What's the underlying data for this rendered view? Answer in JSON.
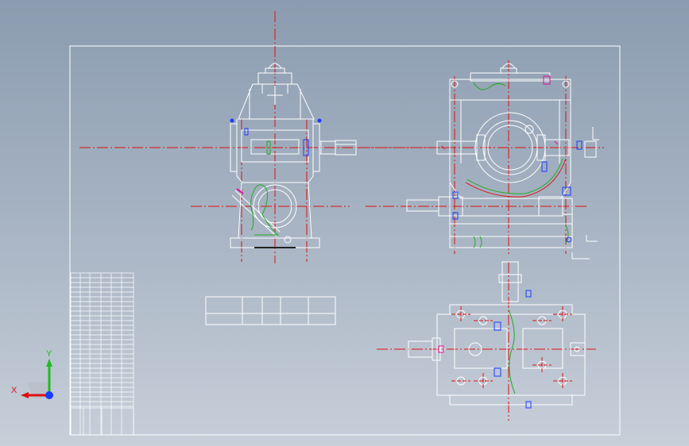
{
  "colors": {
    "background_top": "#8b9cb0",
    "background_bottom": "#c7cfd9",
    "line_white": "#ffffff",
    "centerline_red": "#dd1111",
    "break_green": "#22aa22",
    "part_blue": "#1a3cff",
    "part_magenta": "#e0109a",
    "axis_x": "#dd1111",
    "axis_y": "#22bb22",
    "axis_z": "#1a3cff"
  },
  "axis_triad": {
    "x_label": "X",
    "y_label": "Y"
  },
  "icons": [
    "axis-triad-icon"
  ]
}
